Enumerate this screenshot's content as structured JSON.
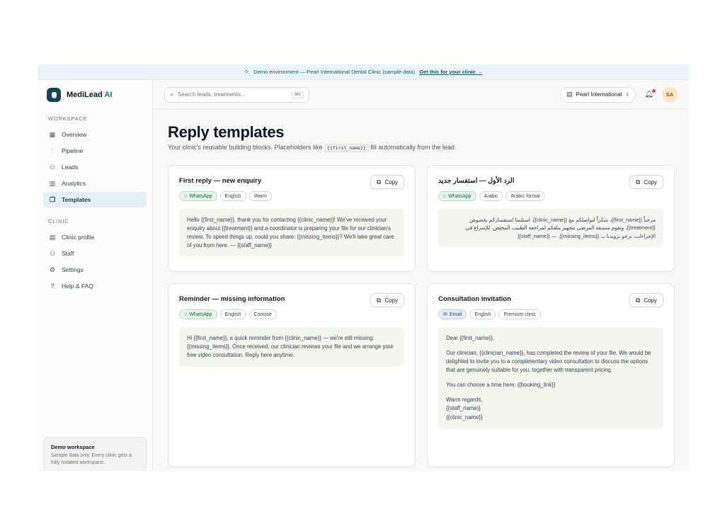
{
  "banner": {
    "text": "Demo environment — Pearl International Dental Clinic (sample data)",
    "link": "Get this for your clinic →"
  },
  "brand": {
    "name": "MediLead",
    "suffix": "AI"
  },
  "sidebar": {
    "workspace_label": "WORKSPACE",
    "workspace_items": [
      {
        "label": "Overview",
        "icon": "grid-icon"
      },
      {
        "label": "Pipeline",
        "icon": "pipeline-icon"
      },
      {
        "label": "Leads",
        "icon": "users-icon"
      },
      {
        "label": "Analytics",
        "icon": "chart-icon"
      },
      {
        "label": "Templates",
        "icon": "templates-icon",
        "active": true
      }
    ],
    "clinic_label": "CLINIC",
    "clinic_items": [
      {
        "label": "Clinic profile",
        "icon": "building-icon"
      },
      {
        "label": "Staff",
        "icon": "staff-icon"
      },
      {
        "label": "Settings",
        "icon": "gear-icon"
      },
      {
        "label": "Help & FAQ",
        "icon": "help-icon"
      }
    ],
    "demo_card": {
      "title": "Demo workspace",
      "desc": "Sample data only. Every clinic gets a fully isolated workspace."
    }
  },
  "topbar": {
    "search_placeholder": "Search leads, treatments...",
    "search_shortcut": "⌘K",
    "clinic": "Pearl International",
    "avatar": "SA"
  },
  "page": {
    "title": "Reply templates",
    "subtitle_before": "Your clinic's reusable building blocks. Placeholders like",
    "subtitle_code": "{{first_name}}",
    "subtitle_after": "fill automatically from the lead."
  },
  "copy_label": "Copy",
  "templates": [
    {
      "title": "First reply — new enquiry",
      "channel": "WhatsApp",
      "language": "English",
      "tone": "Warm",
      "body": "Hello {{first_name}}, thank you for contacting {{clinic_name}}! We've received your enquiry about {{treatment}} and a coordinator is preparing your file for our clinician's review. To speed things up, could you share: {{missing_items}}? We'll take great care of you from here. — {{staff_name}}"
    },
    {
      "title": "الرد الأول — استفسار جديد",
      "channel": "WhatsApp",
      "language": "Arabic",
      "tone": "Arabic formal",
      "body": "مرحباً {{first_name}}، شكراً لتواصلكم مع {{clinic_name}}. استلمنا استفساركم بخصوص {{treatment}}، ونقوم منسقة المرضى بتجهيز ملفكم لمراجعة الطبيب المختص. للإسراع في الإجراءات، نرجو تزويدنا بـ: {{missing_items}}. — {{staff_name}}"
    },
    {
      "title": "Reminder — missing information",
      "channel": "WhatsApp",
      "language": "English",
      "tone": "Concise",
      "body": "Hi {{first_name}}, a quick reminder from {{clinic_name}} — we're still missing: {{missing_items}}. Once received, our clinician reviews your file and we arrange your free video consultation. Reply here anytime."
    },
    {
      "title": "Consultation invitation",
      "channel": "Email",
      "language": "English",
      "tone": "Premium clinic",
      "body_paragraphs": [
        "Dear {{first_name}},",
        "Our clinician, {{clinician_name}}, has completed the review of your file. We would be delighted to invite you to a complimentary video consultation to discuss the options that are genuinely suitable for you, together with transparent pricing.",
        "You can choose a time here: {{booking_link}}",
        "Warm regards,",
        "{{staff_name}}",
        "{{clinic_name}}"
      ]
    }
  ]
}
